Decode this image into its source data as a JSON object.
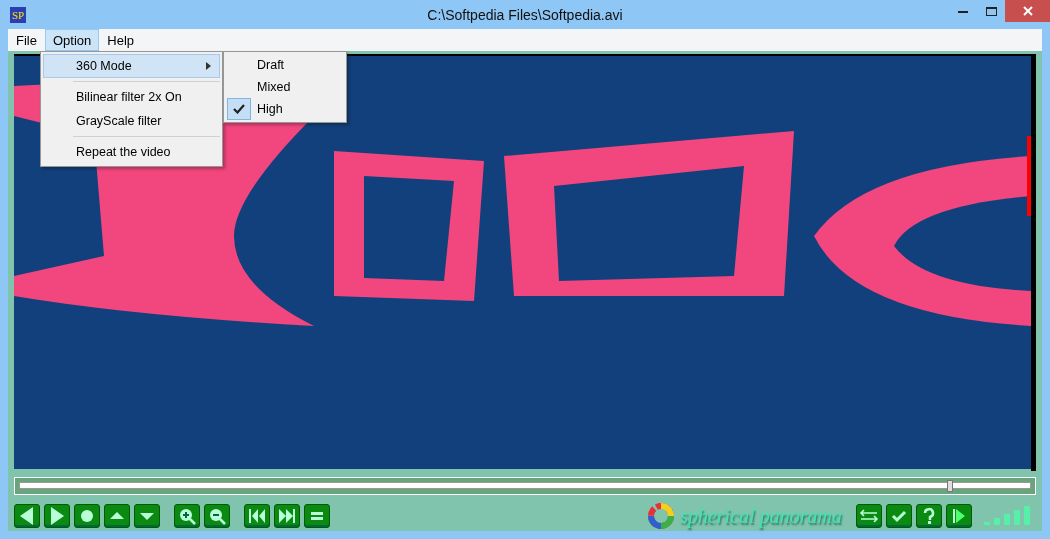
{
  "window": {
    "app_icon": "SP",
    "title": "C:\\Softpedia Files\\Softpedia.avi"
  },
  "menubar": [
    {
      "label": "File",
      "selected": false
    },
    {
      "label": "Option",
      "selected": true
    },
    {
      "label": "Help",
      "selected": false
    }
  ],
  "option_menu": {
    "items": [
      {
        "kind": "submenu",
        "label": "360 Mode",
        "selected": true
      },
      {
        "kind": "separator"
      },
      {
        "kind": "item",
        "label": "Bilinear filter 2x On",
        "selected": false
      },
      {
        "kind": "item",
        "label": "GrayScale filter",
        "selected": false
      },
      {
        "kind": "separator"
      },
      {
        "kind": "item",
        "label": "Repeat the video",
        "selected": false
      }
    ]
  },
  "mode_submenu": {
    "items": [
      {
        "label": "Draft",
        "checked": false
      },
      {
        "label": "Mixed",
        "checked": false
      },
      {
        "label": "High",
        "checked": true
      }
    ]
  },
  "seek_bar": {
    "level": 0.92
  },
  "left_buttons": [
    {
      "kind": "prev"
    },
    {
      "kind": "next"
    },
    {
      "kind": "record"
    },
    {
      "kind": "up"
    },
    {
      "kind": "down"
    },
    {
      "kind": "gap"
    },
    {
      "kind": "zoom-in"
    },
    {
      "kind": "zoom-out"
    },
    {
      "kind": "gap"
    },
    {
      "kind": "rewind"
    },
    {
      "kind": "forward"
    },
    {
      "kind": "equal"
    }
  ],
  "brand": "spherical panorama",
  "right_buttons": [
    {
      "kind": "swap"
    },
    {
      "kind": "check"
    },
    {
      "kind": "help"
    },
    {
      "kind": "play"
    }
  ]
}
